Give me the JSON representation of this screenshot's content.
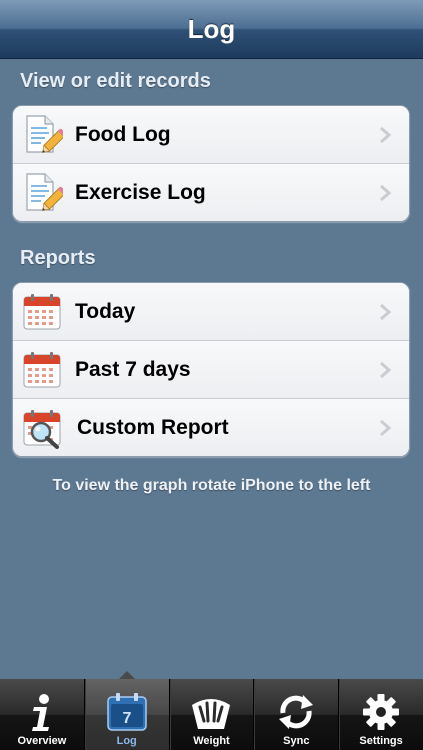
{
  "header": {
    "title": "Log"
  },
  "sections": [
    {
      "title": "View or edit records",
      "rows": [
        {
          "label": "Food Log",
          "icon": "document-pencil-icon"
        },
        {
          "label": "Exercise Log",
          "icon": "document-pencil-icon"
        }
      ]
    },
    {
      "title": "Reports",
      "rows": [
        {
          "label": "Today",
          "icon": "calendar-icon"
        },
        {
          "label": "Past 7 days",
          "icon": "calendar-icon"
        },
        {
          "label": "Custom Report",
          "icon": "calendar-magnifier-icon"
        }
      ]
    }
  ],
  "hint": "To view the graph rotate iPhone to the left",
  "tabs": [
    {
      "label": "Overview",
      "icon": "info-icon"
    },
    {
      "label": "Log",
      "icon": "calendar-7-icon",
      "badge": "7",
      "active": true
    },
    {
      "label": "Weight",
      "icon": "scale-icon"
    },
    {
      "label": "Sync",
      "icon": "sync-arrows-icon"
    },
    {
      "label": "Settings",
      "icon": "gear-icon"
    }
  ],
  "colors": {
    "background": "#5d7891",
    "navbar": "#2f5176",
    "tab_active_label": "#8bb8ea"
  }
}
